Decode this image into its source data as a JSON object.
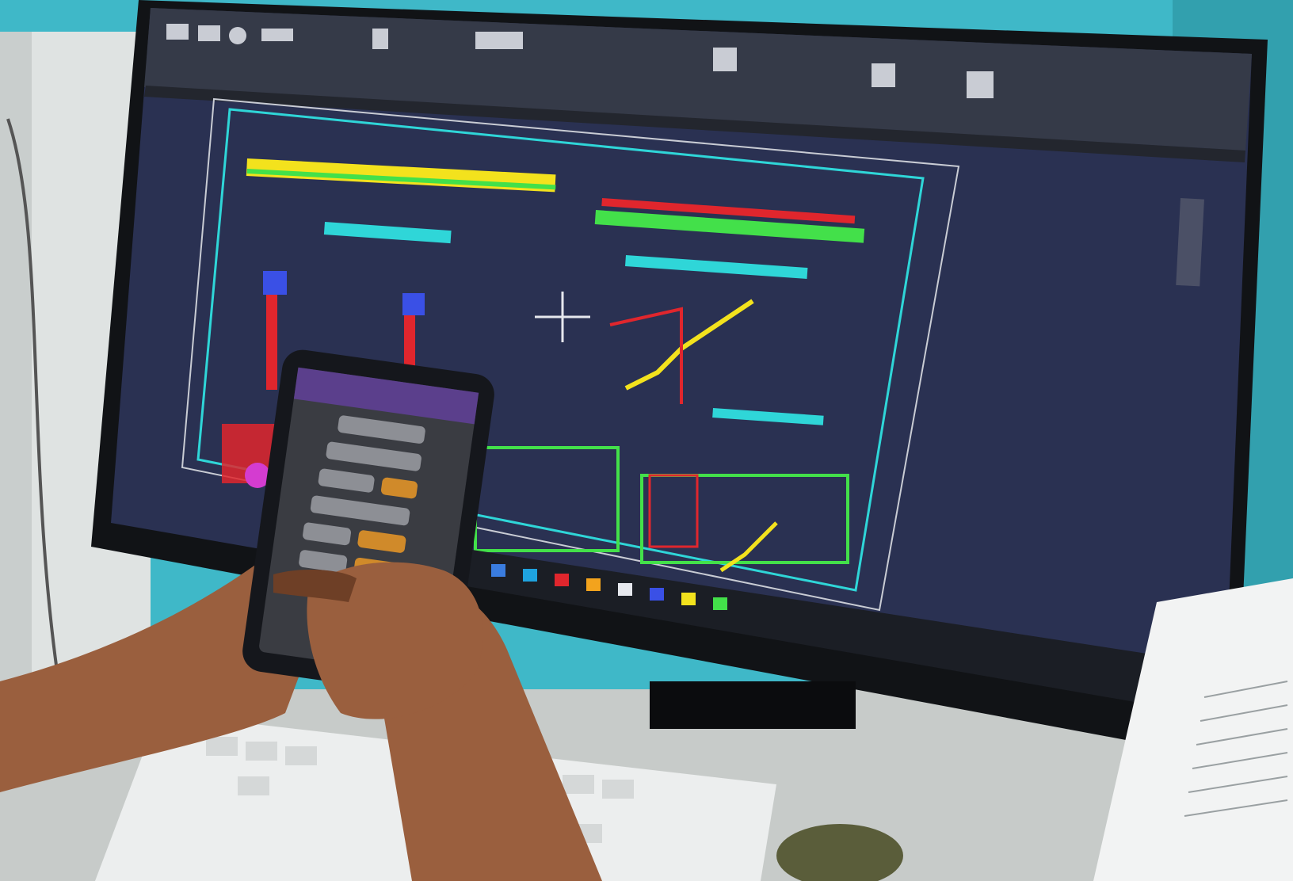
{
  "colors": {
    "wall": "#3fb8c8",
    "wall_dark": "#2a8f9c",
    "desk": "#dfe3e2",
    "monitor_bezel": "#111316",
    "cad_canvas": "#2a3152",
    "cad_ribbon": "#353a48",
    "cad_frame_cyan": "#2fd6d8",
    "cad_yellow": "#f3e21d",
    "cad_green": "#43e04a",
    "cad_red": "#e0262d",
    "cad_blue": "#3a50e6",
    "cad_magenta": "#d43cd0",
    "taskbar": "#1b1e25",
    "phone_body": "#15171c",
    "phone_screen": "#3a3c42",
    "phone_header": "#5b3f8c",
    "phone_button_gray": "#8d8f95",
    "phone_button_orange": "#d08a2a",
    "skin": "#9a5f3e",
    "skin_dark": "#6e3f26",
    "keyboard": "#eceeee",
    "paper": "#f2f3f3"
  },
  "scene": {
    "description_items": [
      "monitor",
      "cad-application",
      "smartphone",
      "hands",
      "keyboard",
      "papers",
      "wall"
    ]
  },
  "cad": {
    "ribbon_icons": [
      "line-icon",
      "polyline-icon",
      "circle-icon",
      "arc-icon",
      "text-icon",
      "layer-icon",
      "properties-icon",
      "block-icon",
      "clipboard-icon"
    ],
    "crosshair_icon": "crosshair-icon"
  },
  "phone": {
    "button_rows": 7
  }
}
